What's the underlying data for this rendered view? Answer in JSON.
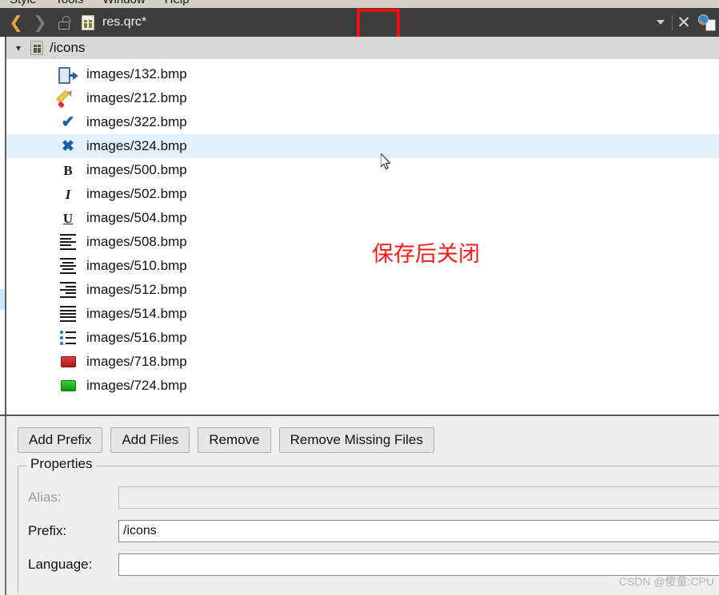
{
  "menubar": {
    "items": [
      "Style",
      "Tools",
      "Window",
      "Help"
    ]
  },
  "titlebar": {
    "back_icon": "chevron-left-icon",
    "forward_icon": "chevron-right-icon",
    "lock_icon": "unlock-icon",
    "file_icon": "qrc-file-icon",
    "title": "res.qrc*",
    "dropdown_icon": "chevron-down-icon",
    "close_icon": "close-icon",
    "extra_icon": "search-document-icon"
  },
  "annotation": {
    "text": "保存后关闭",
    "color": "#ff1a1a",
    "highlight_color": "#ee1111"
  },
  "tree": {
    "prefix": {
      "expander": "▾",
      "icon": "qrc-prefix-icon",
      "label": "/icons"
    },
    "files": [
      {
        "icon": "exit-door-icon",
        "label": "images/132.bmp",
        "selected": false
      },
      {
        "icon": "pencil-icon",
        "label": "images/212.bmp",
        "selected": false
      },
      {
        "icon": "check-mark-icon",
        "label": "images/322.bmp",
        "selected": false
      },
      {
        "icon": "cross-mark-icon",
        "label": "images/324.bmp",
        "selected": true
      },
      {
        "icon": "bold-icon",
        "label": "images/500.bmp",
        "selected": false
      },
      {
        "icon": "italic-icon",
        "label": "images/502.bmp",
        "selected": false
      },
      {
        "icon": "underline-icon",
        "label": "images/504.bmp",
        "selected": false
      },
      {
        "icon": "align-left-icon",
        "label": "images/508.bmp",
        "selected": false
      },
      {
        "icon": "align-center-icon",
        "label": "images/510.bmp",
        "selected": false
      },
      {
        "icon": "align-right-icon",
        "label": "images/512.bmp",
        "selected": false
      },
      {
        "icon": "align-justify-icon",
        "label": "images/514.bmp",
        "selected": false
      },
      {
        "icon": "bullet-list-icon",
        "label": "images/516.bmp",
        "selected": false
      },
      {
        "icon": "red-color-swatch-icon",
        "label": "images/718.bmp",
        "selected": false
      },
      {
        "icon": "green-color-swatch-icon",
        "label": "images/724.bmp",
        "selected": false
      }
    ]
  },
  "buttons": {
    "add_prefix": "Add Prefix",
    "add_files": "Add Files",
    "remove": "Remove",
    "remove_missing": "Remove Missing Files"
  },
  "properties": {
    "legend": "Properties",
    "alias_label": "Alias:",
    "alias_value": "",
    "prefix_label": "Prefix:",
    "prefix_value": "/icons",
    "language_label": "Language:",
    "language_value": ""
  },
  "watermark": {
    "text": "CSDN @傻童:CPU"
  }
}
